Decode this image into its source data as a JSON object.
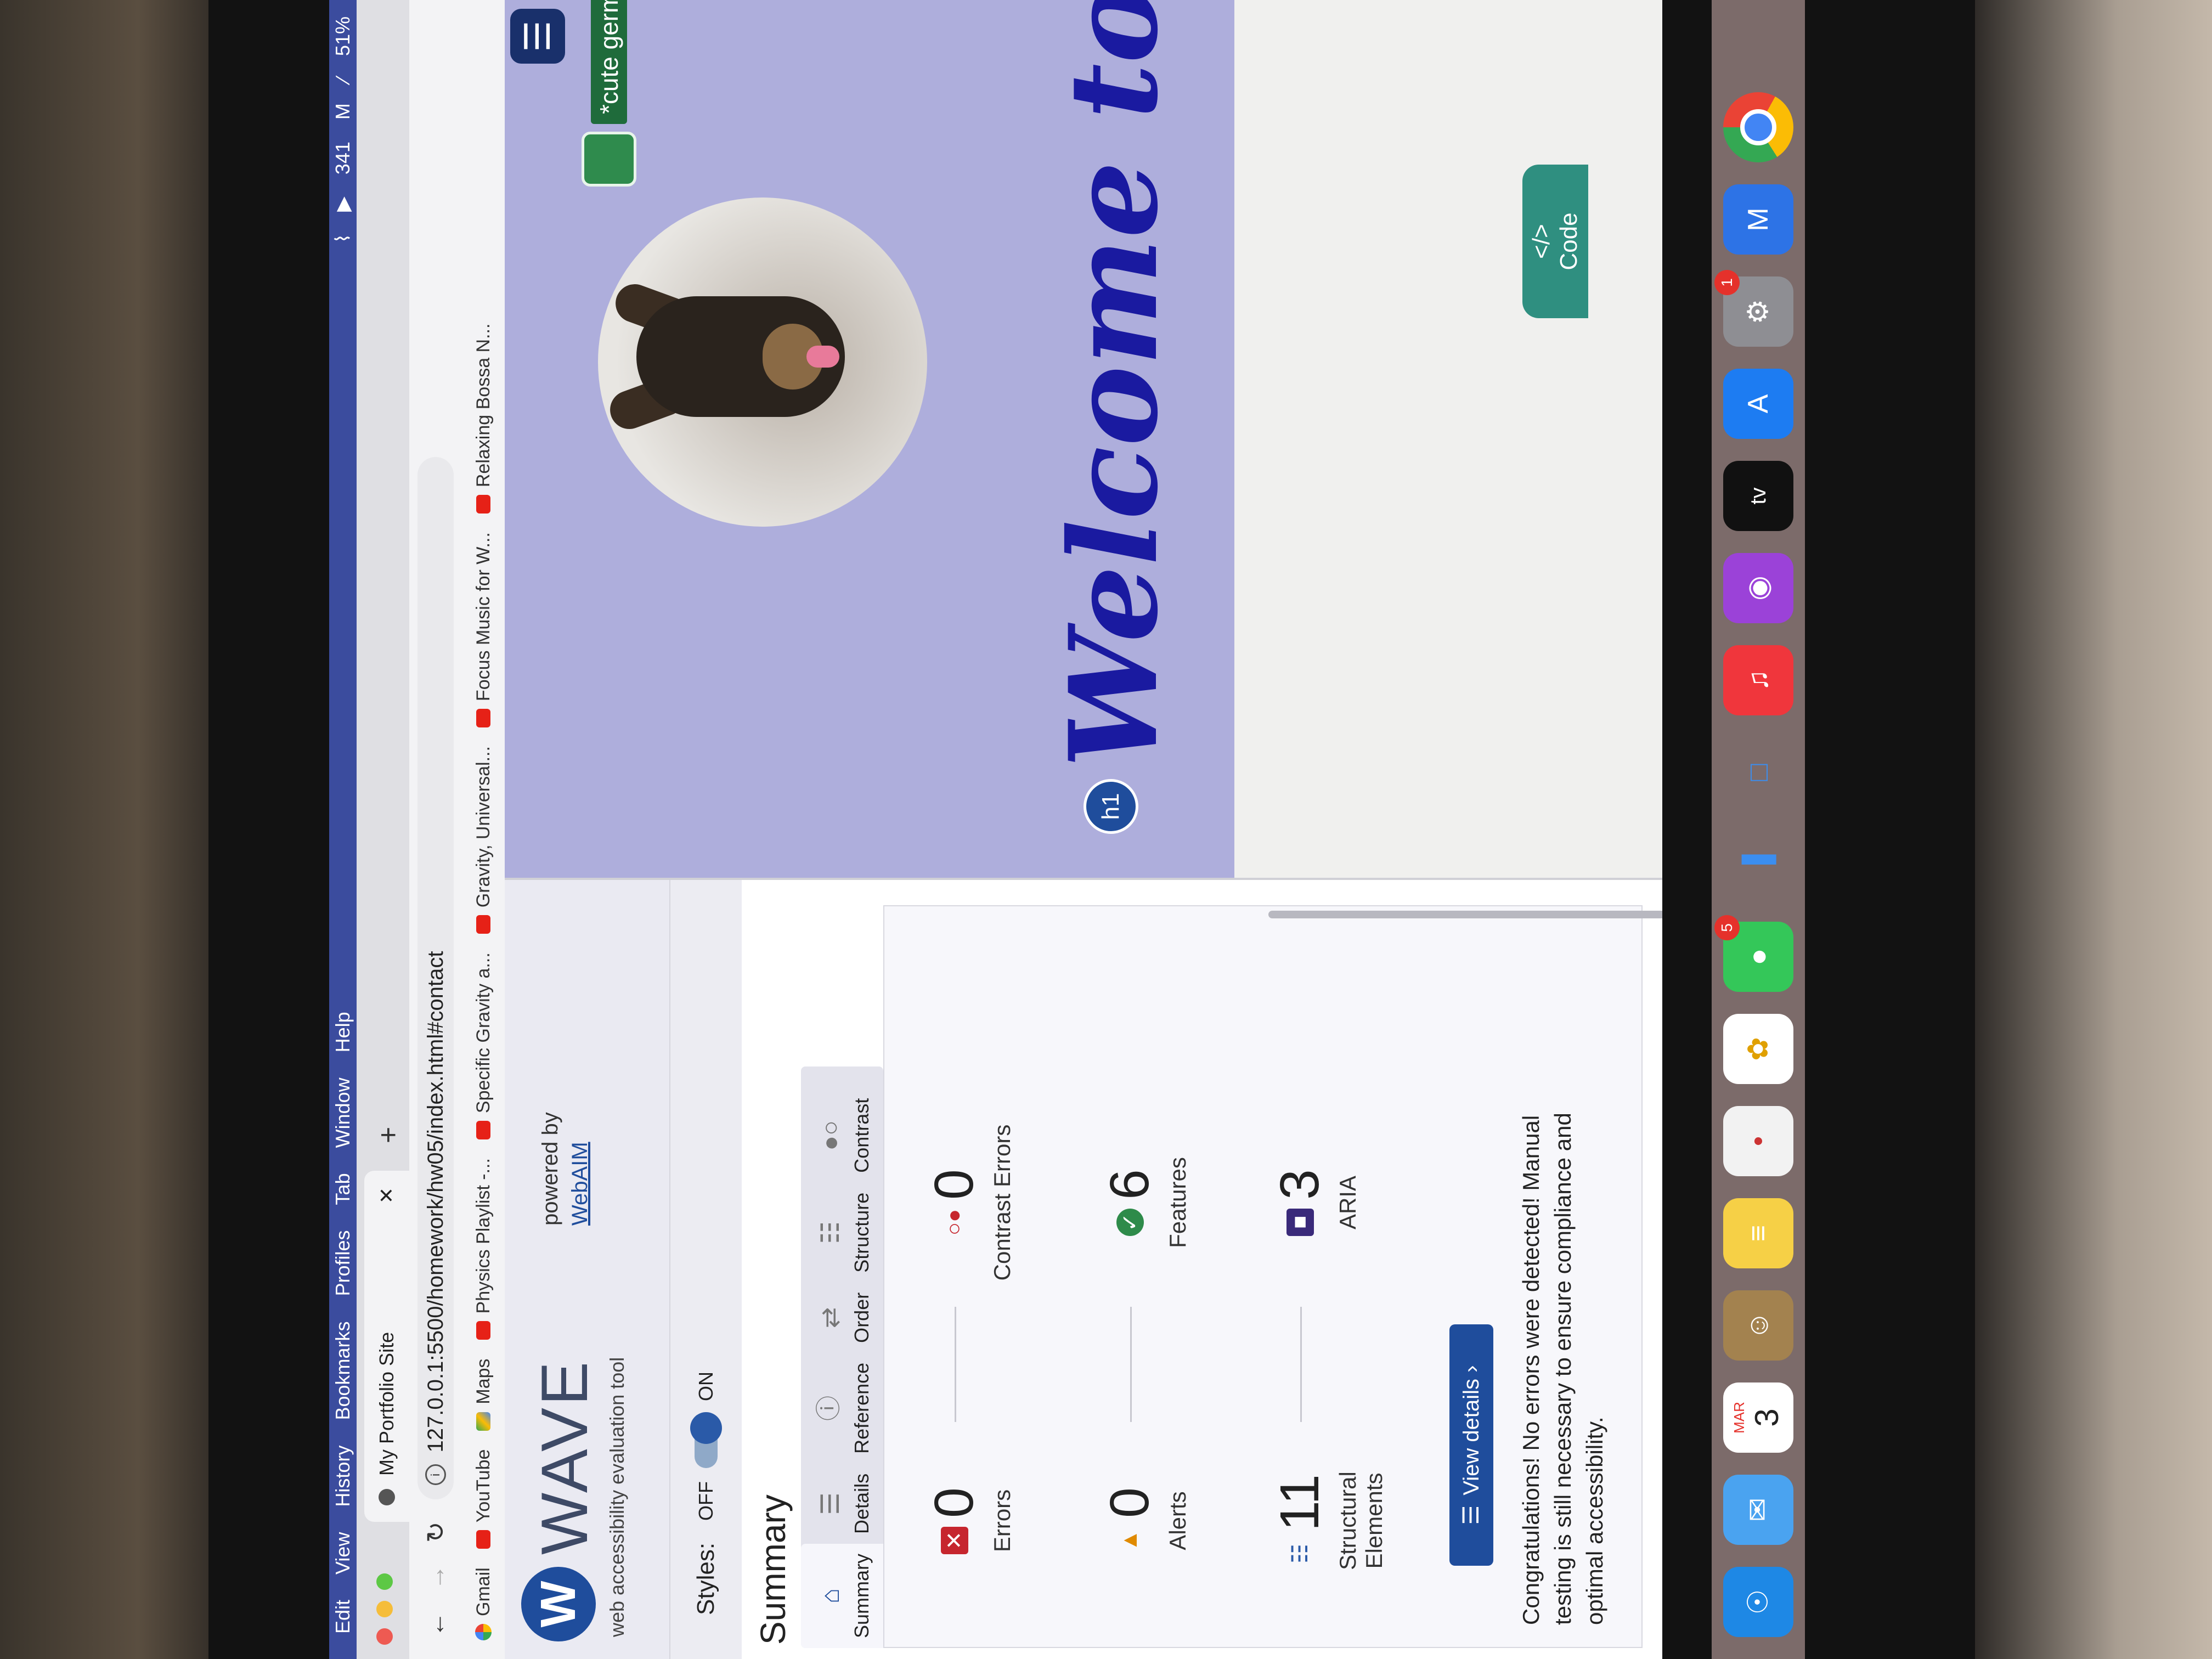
{
  "menubar": {
    "items": [
      "Edit",
      "View",
      "History",
      "Bookmarks",
      "Profiles",
      "Tab",
      "Window",
      "Help"
    ],
    "status": {
      "count": "341",
      "battery": "51%"
    }
  },
  "browser": {
    "tab_title": "My Portfolio Site",
    "url": "127.0.0.1:5500/homework/hw05/index.html#contact",
    "bookmarks": [
      {
        "label": "Gmail",
        "icon": "google"
      },
      {
        "label": "YouTube",
        "icon": "youtube"
      },
      {
        "label": "Maps",
        "icon": "maps"
      },
      {
        "label": "Physics Playlist -...",
        "icon": "youtube"
      },
      {
        "label": "Specific Gravity a...",
        "icon": "youtube"
      },
      {
        "label": "Gravity, Universal...",
        "icon": "youtube"
      },
      {
        "label": "Focus Music for W...",
        "icon": "youtube"
      },
      {
        "label": "Relaxing Bossa N...",
        "icon": "youtube"
      }
    ]
  },
  "wave": {
    "logo_letter": "W",
    "name": "WAVE",
    "tagline": "web accessibility evaluation tool",
    "powered_by": "powered by",
    "powered_link": "WebAIM",
    "styles_label": "Styles:",
    "styles_off": "OFF",
    "styles_on": "ON",
    "summary_title": "Summary",
    "tabs": [
      {
        "label": "Summary",
        "icon": "home-icon"
      },
      {
        "label": "Details",
        "icon": "list-icon"
      },
      {
        "label": "Reference",
        "icon": "info-icon"
      },
      {
        "label": "Order",
        "icon": "order-icon"
      },
      {
        "label": "Structure",
        "icon": "structure-icon"
      },
      {
        "label": "Contrast",
        "icon": "contrast-icon"
      }
    ],
    "stats": {
      "errors": {
        "value": "0",
        "label": "Errors"
      },
      "contrast_errors": {
        "value": "0",
        "label": "Contrast Errors"
      },
      "alerts": {
        "value": "0",
        "label": "Alerts"
      },
      "features": {
        "value": "6",
        "label": "Features"
      },
      "structural": {
        "value": "11",
        "label": "Structural Elements"
      },
      "aria": {
        "value": "3",
        "label": "ARIA"
      }
    },
    "view_details": "View details ›",
    "congrats": "Congratulations! No errors were detected! Manual testing is still necessary to ensure compliance and optimal accessibility."
  },
  "page": {
    "alt_text": "*cute german shepard p",
    "h1_badge": "h1",
    "welcome": "Welcome to my portfoli",
    "code_tab_glyph": "</>",
    "code_tab_label": "Code"
  },
  "dock": {
    "calendar_month": "MAR",
    "calendar_day": "3",
    "messages_badge": "5",
    "settings_badge": "1",
    "tv_label": "tv"
  },
  "colors": {
    "wave_blue": "#1f4d9c",
    "hero_bg": "#aeaedc",
    "welcome_text": "#1a1aa0",
    "menubar": "#3b4c9e"
  }
}
